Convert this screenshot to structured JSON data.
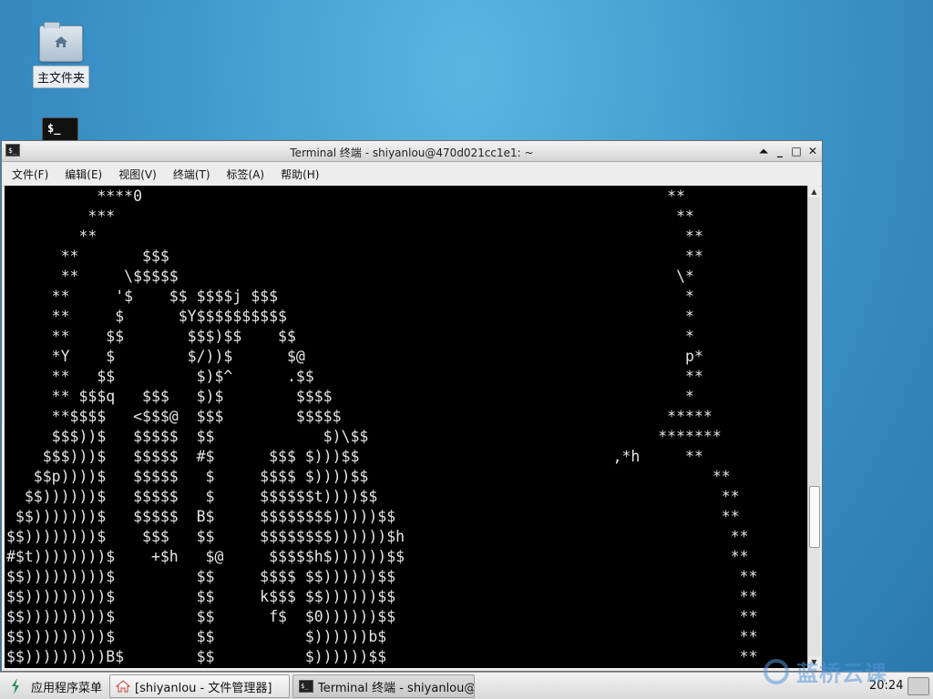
{
  "desktop": {
    "home_folder_label": "主文件夹",
    "terminal_icon_text": "$_"
  },
  "window": {
    "title": "Terminal 终端 - shiyanlou@470d021cc1e1: ~",
    "controls": {
      "shade": "⏶",
      "minimize": "_",
      "maximize": "□",
      "close": "✕"
    },
    "menu": [
      {
        "label": "文件(F)"
      },
      {
        "label": "编辑(E)"
      },
      {
        "label": "视图(V)"
      },
      {
        "label": "终端(T)"
      },
      {
        "label": "标签(A)"
      },
      {
        "label": "帮助(H)"
      }
    ]
  },
  "terminal": {
    "lines": [
      "          ****0                                                          **",
      "         ***                                                              **",
      "        **                                                                 **",
      "      **       $$$                                                         **",
      "      **     \\$$$$$                                                       \\*",
      "     **     '$    $$ $$$$j $$$                                             *",
      "     **     $      $Y$$$$$$$$$$                                            *",
      "     **    $$       $$$)$$    $$                                           *",
      "     *Y    $        $/))$      $@                                          p*",
      "     **   $$         $)$^      .$$                                         **",
      "     ** $$$q   $$$   $)$        $$$$                                       *",
      "     **$$$$   <$$$@  $$$        $$$$$                                    *****",
      "     $$$))$   $$$$$  $$            $)\\$$                                *******",
      "    $$$)))$   $$$$$  #$      $$$ $)))$$                            ,*h     **",
      "   $$p))))$   $$$$$   $     $$$$ $))))$$                                      **",
      "  $$))))))$   $$$$$   $     $$$$$$t))))$$                                      **",
      " $$)))))))$   $$$$$  B$     $$$$$$$$)))))$$                                    **",
      "$$))))))))$    $$$   $$     $$$$$$$$))))))$h                                    **",
      "#$t))))))))$    +$h   $@     $$$$$h$))))))$$                                    **",
      "$$)))))))))$         $$     $$$$ $$))))))$$                                      **",
      "$$)))))))))$         $$     k$$$ $$))))))$$                                      **",
      "$$)))))))))$         $$      f$  $0))))))$$                                      **",
      "$$)))))))))$         $$          $))))))b$                                       **",
      "$$)))))))))B$        $$          $))))))$$                                       **"
    ]
  },
  "taskbar": {
    "start_label": "应用程序菜单",
    "tasks": [
      {
        "label": "[shiyanlou - 文件管理器]"
      },
      {
        "label": "Terminal 终端 - shiyanlou@…"
      }
    ],
    "clock": "20:24"
  },
  "watermark": {
    "text": "蓝桥云课"
  },
  "colors": {
    "terminal_bg": "#000000",
    "terminal_fg": "#e6e6e6",
    "desktop_bg": "#3e97cb"
  }
}
